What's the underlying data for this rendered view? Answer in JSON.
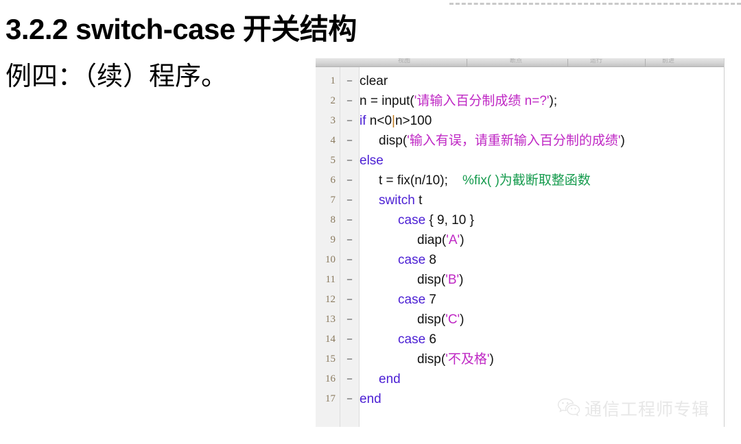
{
  "slide": {
    "title": "3.2.2  switch-case 开关结构",
    "subtitle": "例四：（续）程序。"
  },
  "editor": {
    "toolbar_ghost_left": "视图",
    "toolbar_ghost_2": "断点",
    "toolbar_ghost_3": "运行",
    "toolbar_ghost_4": "前进",
    "lines": [
      {
        "number": "1",
        "fold": "−",
        "indent": 0,
        "tokens": [
          {
            "t": "clear",
            "c": "plain"
          }
        ]
      },
      {
        "number": "2",
        "fold": "−",
        "indent": 0,
        "tokens": [
          {
            "t": "n = input(",
            "c": "plain"
          },
          {
            "t": "'请输入百分制成绩 n=?'",
            "c": "str"
          },
          {
            "t": ");",
            "c": "plain"
          }
        ]
      },
      {
        "number": "3",
        "fold": "−",
        "indent": 0,
        "tokens": [
          {
            "t": "if",
            "c": "kw"
          },
          {
            "t": " n<0",
            "c": "plain"
          },
          {
            "t": "|",
            "c": "cursor"
          },
          {
            "t": "n>100",
            "c": "plain"
          }
        ]
      },
      {
        "number": "4",
        "fold": "−",
        "indent": 1,
        "tokens": [
          {
            "t": "disp(",
            "c": "plain"
          },
          {
            "t": "'输入有误，请重新输入百分制的成绩'",
            "c": "str"
          },
          {
            "t": ")",
            "c": "plain"
          }
        ]
      },
      {
        "number": "5",
        "fold": "−",
        "indent": 0,
        "tokens": [
          {
            "t": "else",
            "c": "kw"
          }
        ]
      },
      {
        "number": "6",
        "fold": "−",
        "indent": 1,
        "tokens": [
          {
            "t": "t = fix(n/10);",
            "c": "plain"
          },
          {
            "t": "    ",
            "c": "plain"
          },
          {
            "t": "%fix( )为截断取整函数",
            "c": "com"
          }
        ]
      },
      {
        "number": "7",
        "fold": "−",
        "indent": 1,
        "tokens": [
          {
            "t": "switch",
            "c": "kw"
          },
          {
            "t": " t",
            "c": "plain"
          }
        ]
      },
      {
        "number": "8",
        "fold": "−",
        "indent": 2,
        "tokens": [
          {
            "t": "case",
            "c": "kw"
          },
          {
            "t": " { 9, 10 }",
            "c": "plain"
          }
        ]
      },
      {
        "number": "9",
        "fold": "−",
        "indent": 3,
        "tokens": [
          {
            "t": "diap(",
            "c": "plain"
          },
          {
            "t": "'A'",
            "c": "str"
          },
          {
            "t": ")",
            "c": "plain"
          }
        ]
      },
      {
        "number": "10",
        "fold": "−",
        "indent": 2,
        "tokens": [
          {
            "t": "case",
            "c": "kw"
          },
          {
            "t": " 8",
            "c": "plain"
          }
        ]
      },
      {
        "number": "11",
        "fold": "−",
        "indent": 3,
        "tokens": [
          {
            "t": "disp(",
            "c": "plain"
          },
          {
            "t": "'B'",
            "c": "str"
          },
          {
            "t": ")",
            "c": "plain"
          }
        ]
      },
      {
        "number": "12",
        "fold": "−",
        "indent": 2,
        "tokens": [
          {
            "t": "case",
            "c": "kw"
          },
          {
            "t": " 7",
            "c": "plain"
          }
        ]
      },
      {
        "number": "13",
        "fold": "−",
        "indent": 3,
        "tokens": [
          {
            "t": "disp(",
            "c": "plain"
          },
          {
            "t": "'C'",
            "c": "str"
          },
          {
            "t": ")",
            "c": "plain"
          }
        ]
      },
      {
        "number": "14",
        "fold": "−",
        "indent": 2,
        "tokens": [
          {
            "t": "case",
            "c": "kw"
          },
          {
            "t": " 6",
            "c": "plain"
          }
        ]
      },
      {
        "number": "15",
        "fold": "−",
        "indent": 3,
        "tokens": [
          {
            "t": "disp(",
            "c": "plain"
          },
          {
            "t": "'不及格'",
            "c": "str"
          },
          {
            "t": ")",
            "c": "plain"
          }
        ]
      },
      {
        "number": "16",
        "fold": "−",
        "indent": 1,
        "tokens": [
          {
            "t": "end",
            "c": "kw"
          }
        ]
      },
      {
        "number": "17",
        "fold": "−",
        "indent": 0,
        "tokens": [
          {
            "t": "end",
            "c": "kw"
          }
        ]
      }
    ]
  },
  "watermark": {
    "text": "通信工程师专辑",
    "logo": "wechat-icon"
  },
  "colors": {
    "keyword": "#4b1fd4",
    "string": "#bf28c4",
    "comment": "#169b4e",
    "plain": "#111111",
    "cursor": "#c07a1e",
    "gutter_bg": "#f1f1f1",
    "watermark": "#e3e3e3",
    "dashed_rule": "#c9c9c9"
  }
}
